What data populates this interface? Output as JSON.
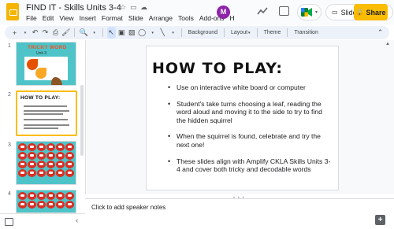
{
  "app": {
    "doc_title": "FIND IT - Skills Units 3-4",
    "menu": [
      "File",
      "Edit",
      "View",
      "Insert",
      "Format",
      "Slide",
      "Arrange",
      "Tools",
      "Add-ons",
      "H"
    ]
  },
  "header_actions": {
    "slideshow_label": "Slideshow",
    "share_label": "Share",
    "extension_icon": "M"
  },
  "toolbar": {
    "background_label": "Background",
    "layout_label": "Layout",
    "theme_label": "Theme",
    "transition_label": "Transition"
  },
  "filmstrip": {
    "slides": [
      {
        "number": "1",
        "title": "TRICKY WORD",
        "subtitle": "Unit 3"
      },
      {
        "number": "2",
        "title": "HOW TO PLAY:"
      },
      {
        "number": "3"
      },
      {
        "number": "4"
      }
    ]
  },
  "slide": {
    "title": "HOW TO PLAY:",
    "bullets": [
      "Use on interactive white board or computer",
      "Student's take turns choosing a leaf, reading the word aloud and moving it to the side to try to find the hidden squirrel",
      "When the squirrel is found, celebrate and try the next one!",
      "These slides align with Amplify CKLA Skills Units 3-4 and cover both tricky and decodable words"
    ]
  },
  "notes": {
    "placeholder": "Click to add speaker notes"
  },
  "colors": {
    "accent_yellow": "#fbbc04",
    "toolbar_bg": "#edf2fa",
    "thumb_teal": "#4ec4c9",
    "leaf_red": "#d93025"
  }
}
